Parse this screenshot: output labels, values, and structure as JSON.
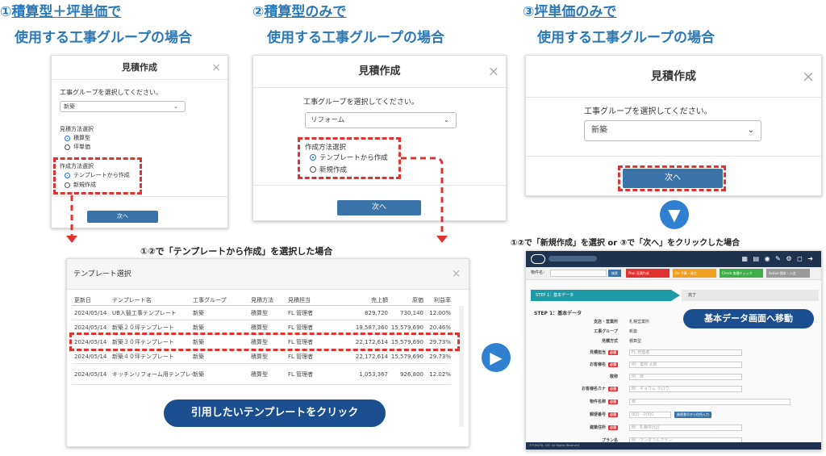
{
  "headings": {
    "h1_line1_prefix": "①",
    "h1_line1": "積算型＋坪単価で",
    "h1_line2": "使用する工事グループの場合",
    "h2_line1_prefix": "②",
    "h2_line1": "積算型のみで",
    "h2_line2": "使用する工事グループの場合",
    "h3_line1_prefix": "③",
    "h3_line1": "坪単価のみで",
    "h3_line2": "使用する工事グループの場合"
  },
  "modal1": {
    "title": "見積作成",
    "close": "×",
    "prompt": "工事グループを選択してください。",
    "select_value": "新築",
    "chevron": "⌄",
    "method_label": "見積方法選択",
    "method_options": [
      "積算型",
      "坪単価"
    ],
    "create_label": "作成方法選択",
    "create_options": [
      "テンプレートから作成",
      "新規作成"
    ],
    "next": "次へ"
  },
  "modal2": {
    "title": "見積作成",
    "close": "×",
    "prompt": "工事グループを選択してください。",
    "select_value": "リフォーム",
    "chevron": "⌄",
    "create_label": "作成方法選択",
    "create_options": [
      "テンプレートから作成",
      "新規作成"
    ],
    "next": "次へ"
  },
  "modal3": {
    "title": "見積作成",
    "close": "×",
    "prompt": "工事グループを選択してください。",
    "select_value": "新築",
    "chevron": "⌄",
    "next": "次へ"
  },
  "notes": {
    "template_case": "①②で「テンプレートから作成」を選択した場合",
    "new_case": "①②で「新規作成」を選択 or ③で「次へ」をクリックした場合"
  },
  "template_modal": {
    "title": "テンプレート選択",
    "close": "×",
    "headers": [
      "更新日",
      "テンプレート名",
      "工事グループ",
      "見積方法",
      "見積担当",
      "売上額",
      "原価",
      "利益率"
    ],
    "rows": [
      [
        "2024/05/14",
        "UB入替工事テンプレート",
        "新築",
        "積算型",
        "FL 管理者",
        "829,720",
        "730,140",
        "12.00%"
      ],
      [
        "2024/05/14",
        "新築２０坪テンプレート",
        "新築",
        "積算型",
        "FL 管理者",
        "19,587,360",
        "15,579,690",
        "20.46%"
      ],
      [
        "2024/05/14",
        "新築３０坪テンプレート",
        "新築",
        "積算型",
        "FL 管理者",
        "22,172,614",
        "15,579,690",
        "29.73%"
      ],
      [
        "2024/05/14",
        "新築４０坪テンプレート",
        "新築",
        "積算型",
        "FL 管理者",
        "22,172,614",
        "15,579,690",
        "29.73%"
      ],
      [
        "2024/05/14",
        "キッチンリフォーム用テンプレート",
        "新築",
        "積算型",
        "FL 管理者",
        "1,053,367",
        "926,800",
        "12.02%"
      ]
    ],
    "callout": "引用したいテンプレートをクリック"
  },
  "basic_screen": {
    "search_label": "物件名：",
    "search_button": "検索",
    "tabs": [
      "Plan 見積作成",
      "Do 予算・発注",
      "Check 各種チェック",
      "Action 請求・入金"
    ],
    "tab_colors": [
      "#e2322f",
      "#f0a020",
      "#3fae48",
      "#9a9a9a"
    ],
    "step1": "STEP 1：基本データ",
    "step_done": "完了",
    "section_title": "STEP 1：基本データ",
    "callout": "基本データ画面へ移動",
    "required": "必須",
    "fields": [
      {
        "label": "支店・営業所",
        "value": "札幌営業所",
        "req": false
      },
      {
        "label": "工事グループ",
        "value": "新築",
        "req": false
      },
      {
        "label": "見積方式",
        "value": "積算型",
        "req": false
      },
      {
        "label": "見積担当",
        "value": "FL 管理者",
        "req": true
      },
      {
        "label": "お客様名",
        "value": "例：業務 太郎",
        "req": true
      },
      {
        "label": "敬称",
        "value": "例：様",
        "req": false
      },
      {
        "label": "お客様名カナ",
        "value": "例：ギョウム タロウ",
        "req": true
      },
      {
        "label": "物件名称",
        "value": "様",
        "req": true
      },
      {
        "label": "郵便番号",
        "value": "000 - 0000",
        "req": true
      },
      {
        "label": "建築住所",
        "value": "例：札幌市北区",
        "req": true
      },
      {
        "label": "プラン名",
        "value": "例：ワンダフルプラン",
        "req": false
      }
    ],
    "zip_button": "郵便番号から住所入力",
    "footer": "©TOKUTA, LTD. All Rights Reserved."
  },
  "colors": {
    "heading": "#2a78b8",
    "dash": "#e2322f",
    "button": "#3a73a8",
    "pill": "#1a4e8e",
    "arrow": "#2f80d1"
  }
}
